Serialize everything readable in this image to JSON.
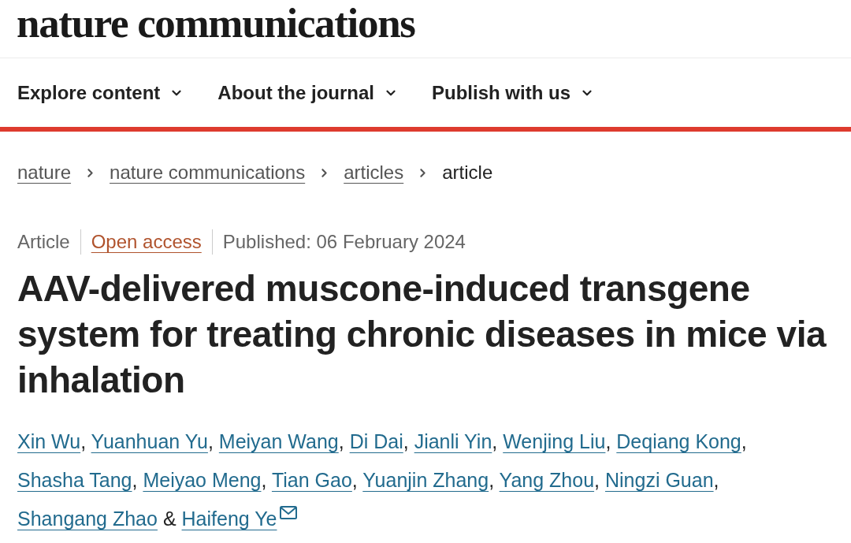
{
  "logo": "nature communications",
  "nav": [
    {
      "label": "Explore content",
      "expanded": false
    },
    {
      "label": "About the journal",
      "expanded": false
    },
    {
      "label": "Publish with us",
      "expanded": false
    }
  ],
  "breadcrumbs": [
    {
      "label": "nature",
      "kind": "link"
    },
    {
      "label": "nature communications",
      "kind": "link"
    },
    {
      "label": "articles",
      "kind": "link"
    },
    {
      "label": "article",
      "kind": "current"
    }
  ],
  "article_meta": [
    {
      "text": "Article",
      "kind": "type"
    },
    {
      "text": "Open access",
      "kind": "access"
    },
    {
      "text": "Published: 06 February 2024",
      "kind": "date"
    }
  ],
  "title": "AAV-delivered muscone-induced transgene system for treating chronic diseases in mice via inhalation",
  "authors": [
    {
      "name": "Xin Wu",
      "separator": {
        "text": ",",
        "kind": "comma"
      },
      "corresponding": false
    },
    {
      "name": "Yuanhuan Yu",
      "separator": {
        "text": ",",
        "kind": "comma"
      },
      "corresponding": false
    },
    {
      "name": "Meiyan Wang",
      "separator": {
        "text": ",",
        "kind": "comma"
      },
      "corresponding": false
    },
    {
      "name": "Di Dai",
      "separator": {
        "text": ",",
        "kind": "comma"
      },
      "corresponding": false
    },
    {
      "name": "Jianli Yin",
      "separator": {
        "text": ",",
        "kind": "comma"
      },
      "corresponding": false
    },
    {
      "name": "Wenjing Liu",
      "separator": {
        "text": ",",
        "kind": "comma"
      },
      "corresponding": false
    },
    {
      "name": "Deqiang Kong",
      "separator": {
        "text": ",",
        "kind": "comma"
      },
      "corresponding": false
    },
    {
      "name": "Shasha Tang",
      "separator": {
        "text": ",",
        "kind": "comma"
      },
      "corresponding": false
    },
    {
      "name": "Meiyao Meng",
      "separator": {
        "text": ",",
        "kind": "comma"
      },
      "corresponding": false
    },
    {
      "name": "Tian Gao",
      "separator": {
        "text": ",",
        "kind": "comma"
      },
      "corresponding": false
    },
    {
      "name": "Yuanjin Zhang",
      "separator": {
        "text": ",",
        "kind": "comma"
      },
      "corresponding": false
    },
    {
      "name": "Yang Zhou",
      "separator": {
        "text": ",",
        "kind": "comma"
      },
      "corresponding": false
    },
    {
      "name": "Ningzi Guan",
      "separator": {
        "text": ",",
        "kind": "comma"
      },
      "corresponding": false
    },
    {
      "name": "Shangang Zhao",
      "separator": {
        "text": "&",
        "kind": "conjunction"
      },
      "corresponding": false
    },
    {
      "name": "Haifeng Ye",
      "corresponding": true
    }
  ]
}
